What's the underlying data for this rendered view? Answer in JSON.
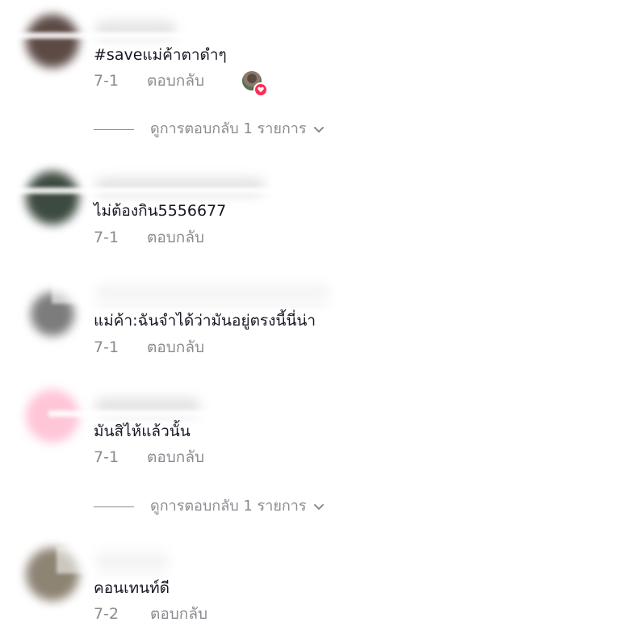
{
  "comments": [
    {
      "text": "#saveแม่ค้าตาดำๆ",
      "date": "7-1",
      "reply_label": "ตอบกลับ",
      "liked_by_creator": true,
      "avatar_color": "#5d4a45"
    },
    {
      "text": "ไม่ต้องกิน5556677",
      "date": "7-1",
      "reply_label": "ตอบกลับ",
      "avatar_color": "#3d4a40"
    },
    {
      "text": "แม่ค้า:ฉันจำได้ว่ามันอยู่ตรงนี้นี่น่า",
      "date": "7-1",
      "reply_label": "ตอบกลับ",
      "avatar_color": "#7c7c7c"
    },
    {
      "text": "มันสิไห้แล้วนั้น",
      "date": "7-1",
      "reply_label": "ตอบกลับ",
      "avatar_color": "#ffc6d8"
    },
    {
      "text": "คอนเทนท์ดี",
      "date": "7-2",
      "reply_label": "ตอบกลับ",
      "avatar_color": "#8e8474"
    }
  ],
  "view_replies": [
    {
      "label": "ดูการตอบกลับ 1 รายการ",
      "icon": "chevron-down-icon"
    },
    {
      "label": "ดูการตอบกลับ 1 รายการ",
      "icon": "chevron-down-icon"
    }
  ],
  "colors": {
    "text": "#161823",
    "muted": "#8a8b91",
    "accent": "#fe2c55"
  }
}
